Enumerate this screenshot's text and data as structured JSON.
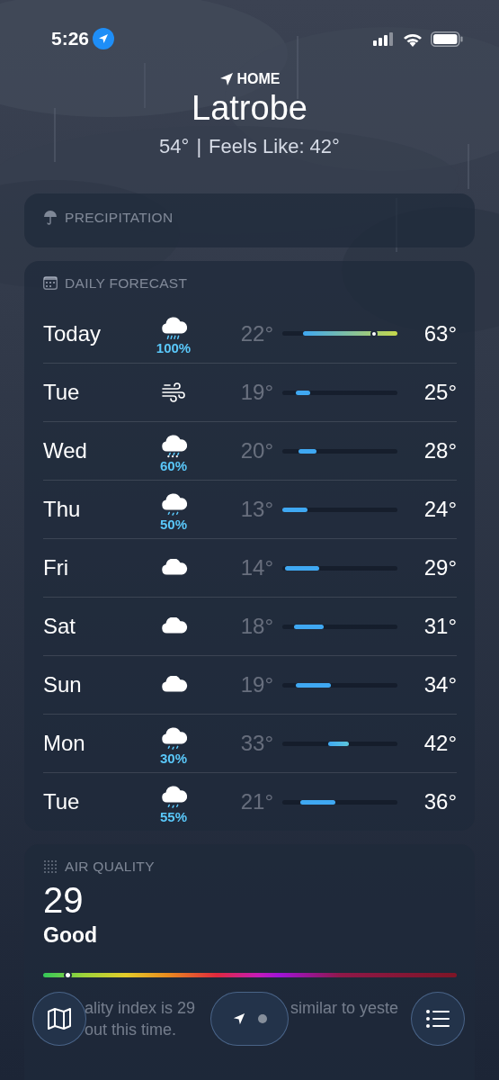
{
  "status_bar": {
    "time": "5:26"
  },
  "header": {
    "label": "HOME",
    "city": "Latrobe",
    "temperature": "54°",
    "separator": "|",
    "feels_like": "Feels Like: 42°"
  },
  "precipitation": {
    "title": "PRECIPITATION"
  },
  "daily_forecast": {
    "title": "DAILY FORECAST",
    "days": [
      {
        "day": "Today",
        "kind": "rain",
        "chance": "100%",
        "low": "22°",
        "high": "63°",
        "level": 0.8
      },
      {
        "day": "Tue",
        "kind": "wind",
        "low": "19°",
        "high": "25°"
      },
      {
        "day": "Wed",
        "kind": "sleet",
        "chance": "60%",
        "low": "20°",
        "high": "28°"
      },
      {
        "day": "Thu",
        "kind": "drizzle",
        "chance": "50%",
        "low": "13°",
        "high": "24°"
      },
      {
        "day": "Fri",
        "kind": "cloud",
        "low": "14°",
        "high": "29°"
      },
      {
        "day": "Sat",
        "kind": "cloud",
        "low": "18°",
        "high": "31°"
      },
      {
        "day": "Sun",
        "kind": "cloud",
        "low": "19°",
        "high": "34°"
      },
      {
        "day": "Mon",
        "kind": "drizzle",
        "chance": "30%",
        "low": "33°",
        "high": "42°"
      },
      {
        "day": "Tue",
        "kind": "drizzle",
        "chance": "55%",
        "low": "21°",
        "high": "36°"
      }
    ]
  },
  "air_quality": {
    "title": "AIR QUALITY",
    "value": "29",
    "category": "Good",
    "level": 0.06,
    "description_parts": [
      "ality index is 29",
      "similar to yeste",
      "out this time."
    ]
  }
}
